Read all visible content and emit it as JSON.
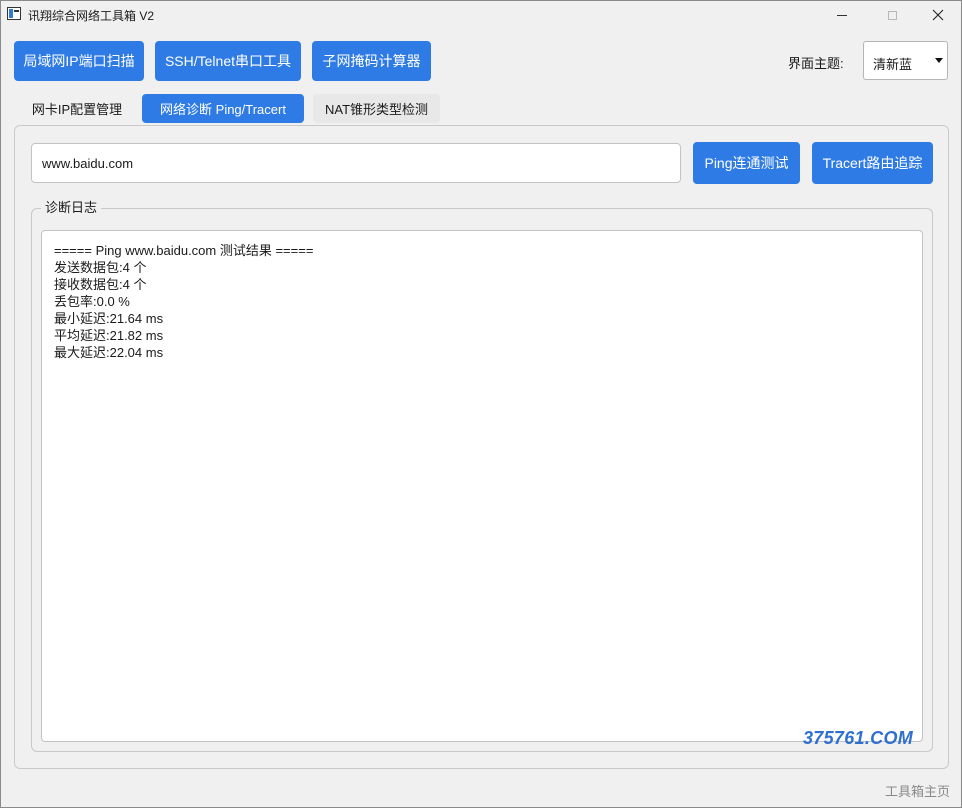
{
  "window": {
    "title": "讯翔综合网络工具箱 V2"
  },
  "toolbar": {
    "buttons": [
      {
        "label": "局域网IP端口扫描"
      },
      {
        "label": "SSH/Telnet串口工具"
      },
      {
        "label": "子网掩码计算器"
      }
    ],
    "theme_label": "界面主题:",
    "theme_value": "清新蓝"
  },
  "tabs": [
    {
      "label": "网卡IP配置管理",
      "active": false
    },
    {
      "label": "网络诊断 Ping/Tracert",
      "active": true
    },
    {
      "label": "NAT锥形类型检测",
      "active": false
    }
  ],
  "diagnostics": {
    "target_value": "www.baidu.com",
    "ping_button": "Ping连通测试",
    "tracert_button": "Tracert路由追踪",
    "log_title": "诊断日志",
    "log_lines": [
      "===== Ping www.baidu.com 测试结果 =====",
      "发送数据包:4 个",
      "接收数据包:4 个",
      "丢包率:0.0 %",
      "最小延迟:21.64 ms",
      "平均延迟:21.82 ms",
      "最大延迟:22.04 ms"
    ]
  },
  "watermark": "375761.COM",
  "footer": {
    "home_link": "工具箱主页"
  },
  "colors": {
    "accent": "#2f7be5",
    "background": "#f0f0f0"
  }
}
